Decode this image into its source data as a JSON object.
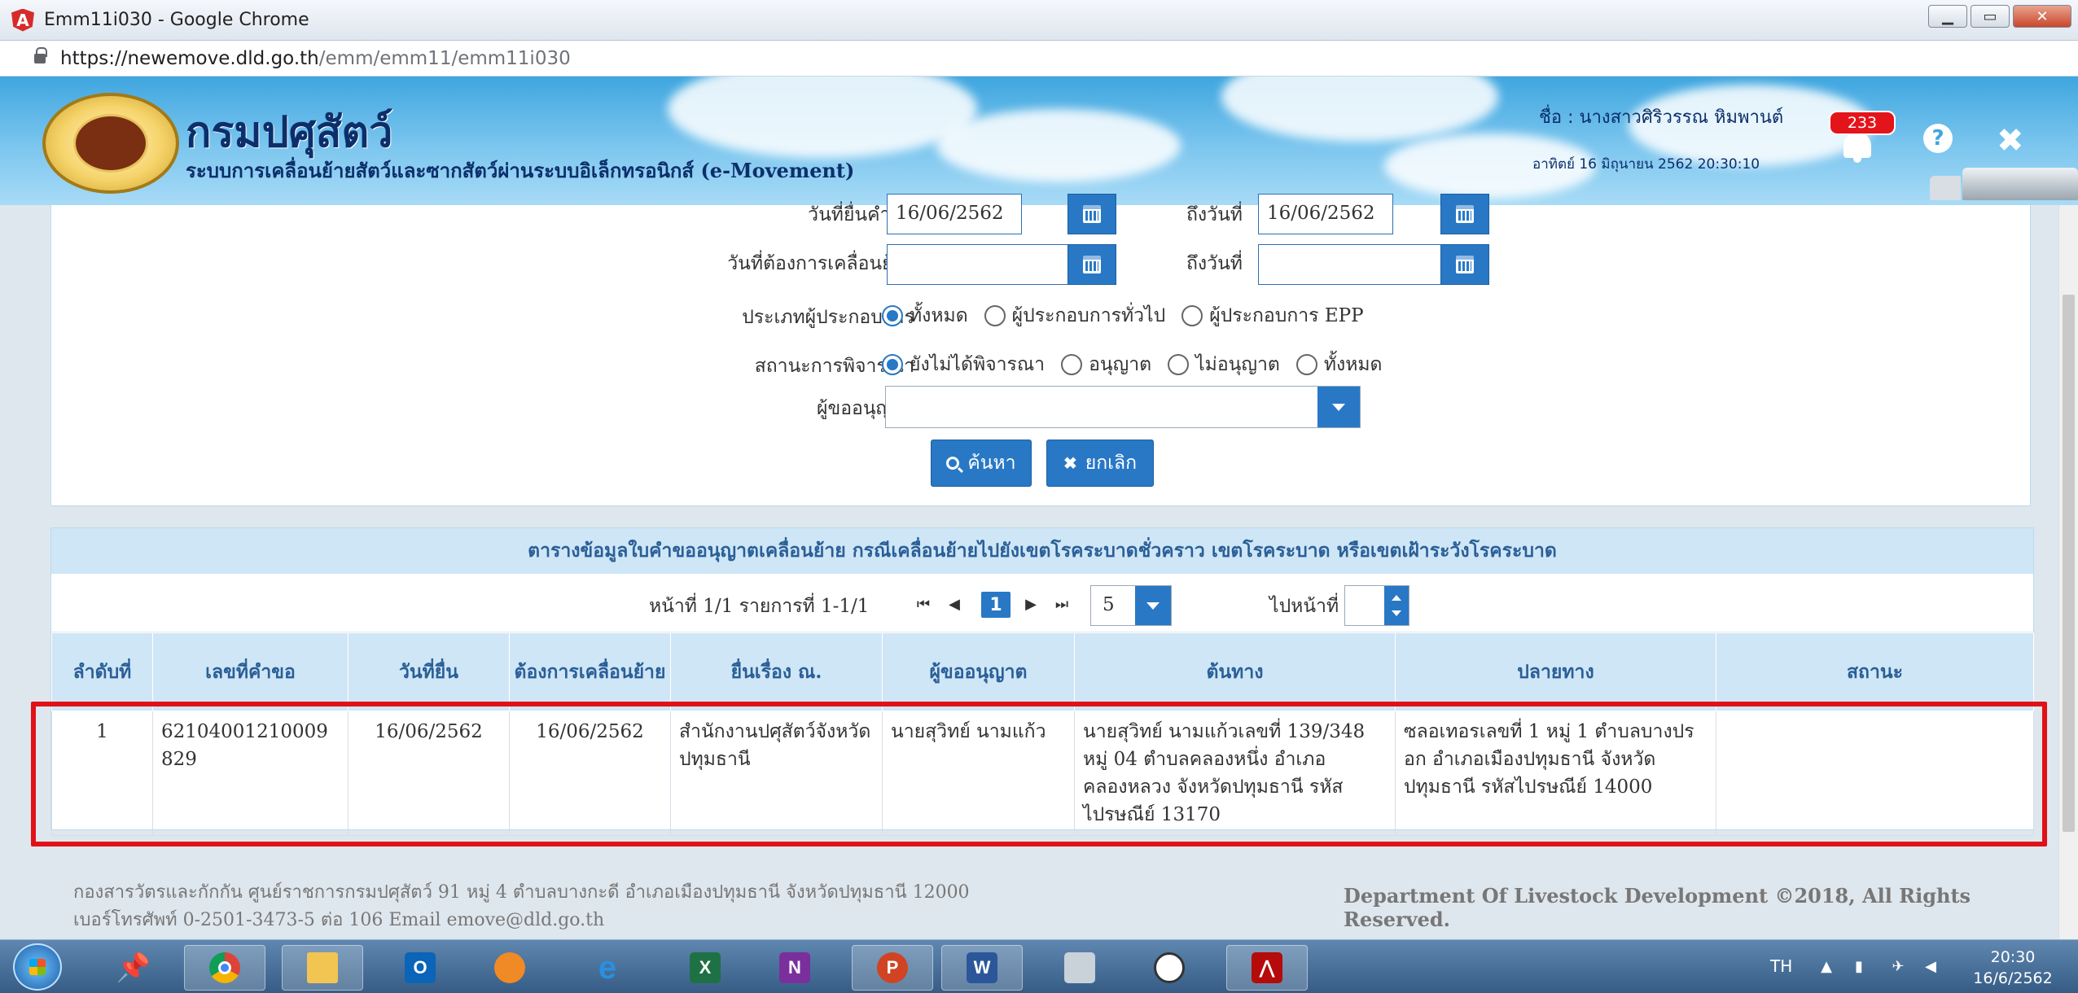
{
  "window": {
    "title": "Emm11i030 - Google Chrome",
    "minimize": "▁",
    "maximize": "▭",
    "close": "✕"
  },
  "address": {
    "url_host": "https://newemove.dld.go.th",
    "url_path": "/emm/emm11/emm11i030"
  },
  "header": {
    "org_name": "กรมปศุสัตว์",
    "org_subtitle": "ระบบการเคลื่อนย้ายสัตว์และซากสัตว์ผ่านระบบอิเล็กทรอนิกส์ (e-Movement)",
    "user_label": "ชื่อ :  นางสาวศิริวรรณ หิมพานต์",
    "datetime": "อาทิตย์ 16 มิถุนายน 2562 20:30:10",
    "notification_count": "233",
    "help": "?",
    "close": "✖"
  },
  "search": {
    "request_date_label": "วันที่ยื่นคำขอ",
    "request_date_from": "16/06/2562",
    "to_date_label": "ถึงวันที่",
    "request_date_to": "16/06/2562",
    "move_date_label": "วันที่ต้องการเคลื่อนย้าย",
    "move_date_from": "",
    "move_to_date_label": "ถึงวันที่",
    "move_date_to": "",
    "operator_type_label": "ประเภทผู้ประกอบการ",
    "operator_type_options": [
      "ทั้งหมด",
      "ผู้ประกอบการทั่วไป",
      "ผู้ประกอบการ EPP"
    ],
    "status_label": "สถานะการพิจารณา",
    "status_options": [
      "ยังไม่ได้พิจารณา",
      "อนุญาต",
      "ไม่อนุญาต",
      "ทั้งหมด"
    ],
    "applicant_label": "ผู้ขออนุญาต",
    "applicant_value": "",
    "search_button": "ค้นหา",
    "cancel_button": "ยกเลิก"
  },
  "results": {
    "title": "ตารางข้อมูลใบคำขออนุญาตเคลื่อนย้าย กรณีเคลื่อนย้ายไปยังเขตโรคระบาดชั่วคราว เขตโรคระบาด หรือเขตเฝ้าระวังโรคระบาด",
    "pager_info": "หน้าที่ 1/1 รายการที่ 1-1/1",
    "first": "⏮",
    "prev": "◀",
    "current_page": "1",
    "next": "▶",
    "last": "⏭",
    "page_size": "5",
    "goto_label": "ไปหน้าที่",
    "columns": [
      "ลำดับที่",
      "เลขที่คำขอ",
      "วันที่ยื่น",
      "ต้องการเคลื่อนย้าย",
      "ยื่นเรื่อง ณ.",
      "ผู้ขออนุญาต",
      "ต้นทาง",
      "ปลายทาง",
      "สถานะ"
    ],
    "rows": [
      {
        "no": "1",
        "request_no": "62104001210009829",
        "submit_date": "16/06/2562",
        "move_date": "16/06/2562",
        "office": "สำนักงานปศุสัตว์จังหวัดปทุมธานี",
        "applicant": "นายสุวิทย์ นามแก้ว",
        "origin": "นายสุวิทย์ นามแก้วเลขที่ 139/348 หมู่ 04 ตำบลคลองหนึ่ง อำเภอคลองหลวง จังหวัดปทุมธานี รหัสไปรษณีย์ 13170",
        "destination": "ซลอเทอรเลขที่ 1 หมู่ 1 ตำบลบางปรอก อำเภอเมืองปทุมธานี จังหวัดปทุมธานี รหัสไปรษณีย์ 14000",
        "status": ""
      }
    ]
  },
  "footer": {
    "address": "กองสารวัตรและกักกัน ศูนย์ราชการกรมปศุสัตว์ 91 หมู่ 4 ตำบลบางกะดี อำเภอเมืองปทุมธานี จังหวัดปทุมธานี 12000",
    "contact": "เบอร์โทรศัพท์ 0-2501-3473-5 ต่อ 106 Email emove@dld.go.th",
    "copyright": "Department Of Livestock Development ©2018, All Rights Reserved."
  },
  "taskbar": {
    "outlook": "O",
    "excel": "X",
    "onenote": "N",
    "powerpoint": "P",
    "word": "W",
    "lang": "TH",
    "time": "20:30",
    "date": "16/6/2562"
  },
  "colors": {
    "primary": "#2878c6",
    "header_sky": "#3fa6df",
    "highlight": "#e01218",
    "table_header": "#cfe6f6"
  }
}
